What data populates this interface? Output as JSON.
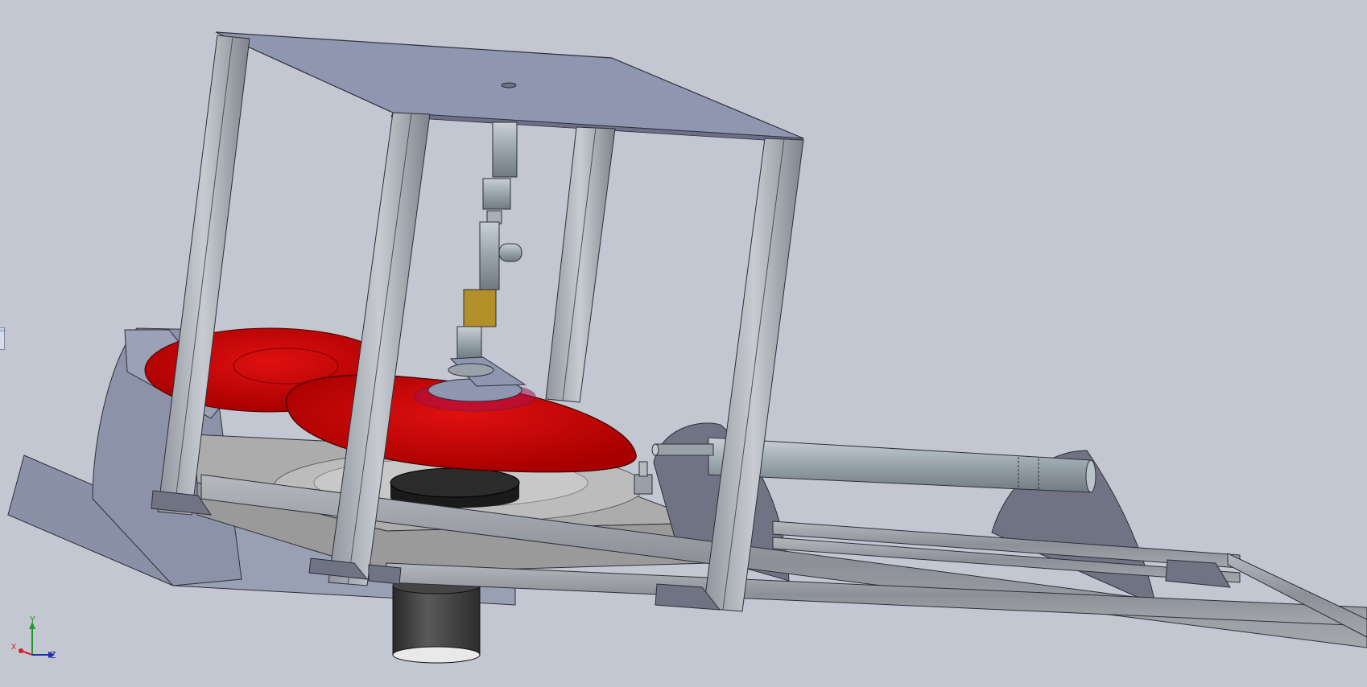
{
  "viewport": {
    "background": "#c3c7d1",
    "model_colors": {
      "plate": "#8f96b0",
      "extrusion": "#9a9ea5",
      "disc": "#cc0000",
      "base_block": "#a9a9a9",
      "weight": "#1a1a1a",
      "motor": "#3a3a3a",
      "shaft": "#a3acb4",
      "coupler": "#b38f2a",
      "bracket": "#6f7383"
    }
  },
  "triad": {
    "x_label": "X",
    "y_label": "Y",
    "z_label": "Z",
    "x_color": "#d22020",
    "y_color": "#1f9a2a",
    "z_color": "#1c2fa8"
  },
  "panel_handle": {
    "glyph": "‹‹‹"
  }
}
